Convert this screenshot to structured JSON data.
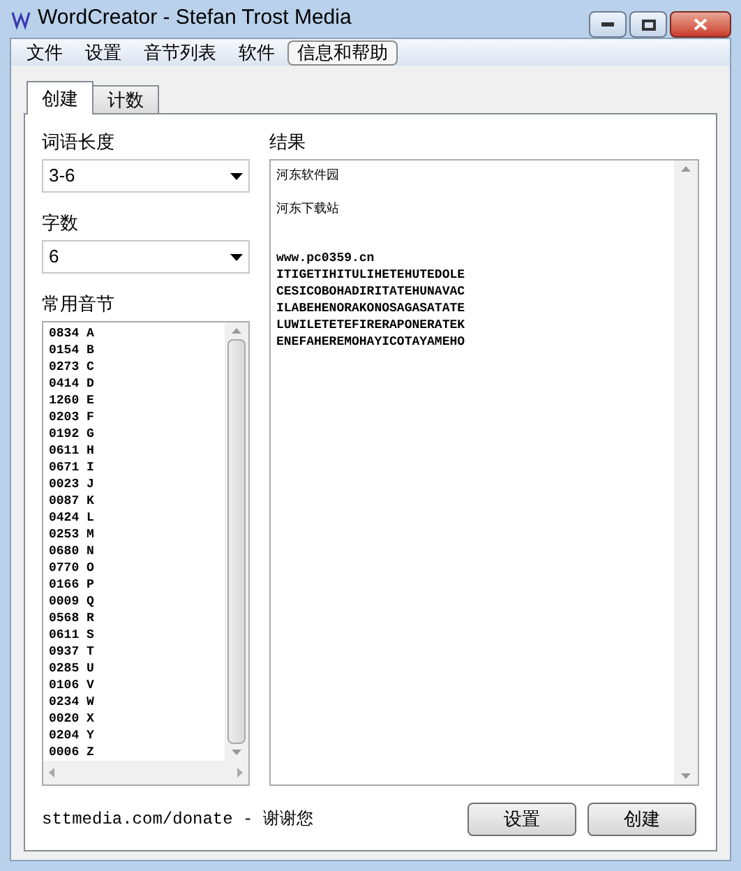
{
  "window": {
    "title": "WordCreator - Stefan Trost Media"
  },
  "menu": [
    {
      "label": "文件",
      "selected": false
    },
    {
      "label": "设置",
      "selected": false
    },
    {
      "label": "音节列表",
      "selected": false
    },
    {
      "label": "软件",
      "selected": false
    },
    {
      "label": "信息和帮助",
      "selected": true
    }
  ],
  "tabs": [
    {
      "label": "创建",
      "selected": true
    },
    {
      "label": "计数",
      "selected": false
    }
  ],
  "word_length": {
    "label": "词语长度",
    "value": "3-6"
  },
  "word_count": {
    "label": "字数",
    "value": "6"
  },
  "syllables": {
    "label": "常用音节",
    "items": [
      "0834 A",
      "0154 B",
      "0273 C",
      "0414 D",
      "1260 E",
      "0203 F",
      "0192 G",
      "0611 H",
      "0671 I",
      "0023 J",
      "0087 K",
      "0424 L",
      "0253 M",
      "0680 N",
      "0770 O",
      "0166 P",
      "0009 Q",
      "0568 R",
      "0611 S",
      "0937 T",
      "0285 U",
      "0106 V",
      "0234 W",
      "0020 X",
      "0204 Y",
      "0006 Z"
    ]
  },
  "result": {
    "label": "结果",
    "notes": [
      "河东软件园",
      "河东下载站"
    ],
    "lines": [
      "www.pc0359.cn",
      "ITIGETIHITULIHETEHUTEDOLE",
      "CESICOBOHADIRITATEHUNAVAC",
      "ILABEHENORAKONOSAGASATATE",
      "LUWILETETEFIRERAPONERATEK",
      "ENEFAHEREMOHAYICOTAYAMEHO"
    ]
  },
  "footer": {
    "donate": "sttmedia.com/donate - 谢谢您",
    "buttons": [
      "设置",
      "创建"
    ]
  }
}
